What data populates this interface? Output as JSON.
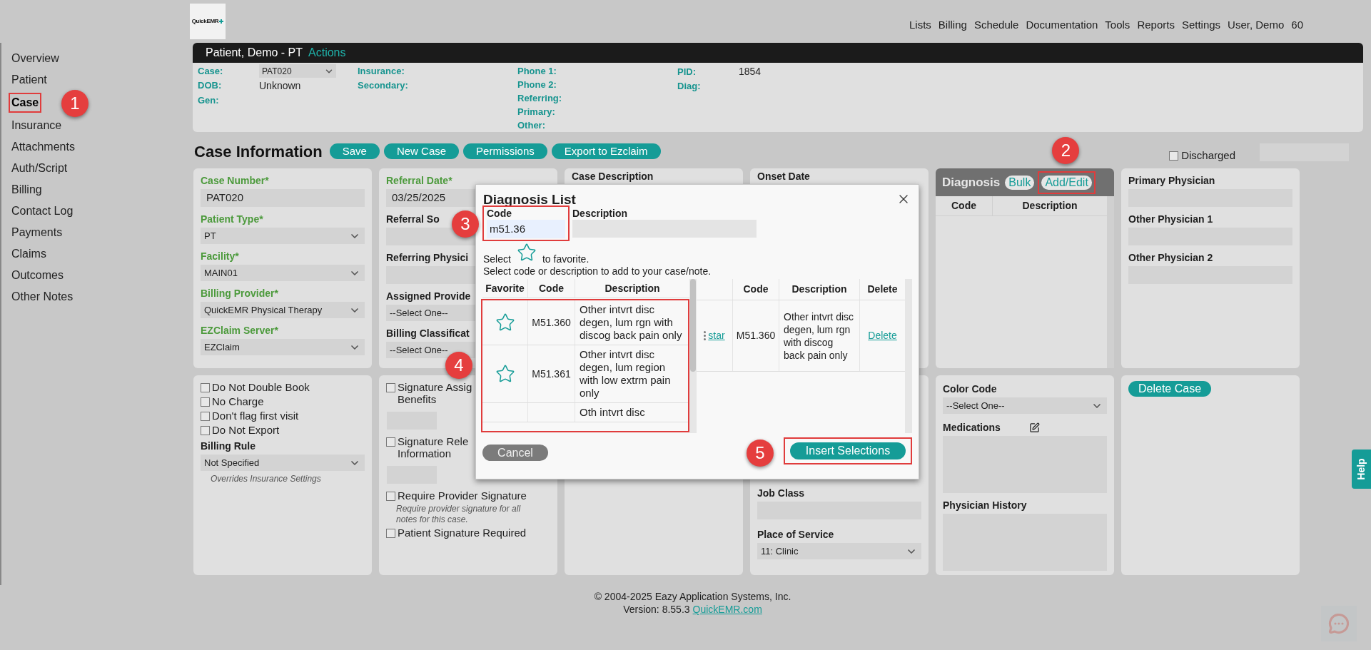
{
  "header": {
    "logo": "QuickEMR",
    "menu": [
      "Lists",
      "Billing",
      "Schedule",
      "Documentation",
      "Tools",
      "Reports",
      "Settings",
      "User, Demo",
      "60"
    ]
  },
  "nav": [
    {
      "label": "Overview",
      "selected": false
    },
    {
      "label": "Patient",
      "selected": false
    },
    {
      "label": "Case",
      "selected": true,
      "callout": "1"
    },
    {
      "label": "Insurance",
      "selected": false
    },
    {
      "label": "Attachments",
      "selected": false
    },
    {
      "label": "Auth/Script",
      "selected": false
    },
    {
      "label": "Billing",
      "selected": false
    },
    {
      "label": "Contact Log",
      "selected": false
    },
    {
      "label": "Payments",
      "selected": false
    },
    {
      "label": "Claims",
      "selected": false
    },
    {
      "label": "Outcomes",
      "selected": false
    },
    {
      "label": "Other Notes",
      "selected": false
    }
  ],
  "patient": {
    "name": "Patient, Demo - PT",
    "actions": "Actions",
    "columns": [
      [
        {
          "label": "Case:",
          "value": "PAT020",
          "kind": "select"
        },
        {
          "label": "DOB:",
          "value": "Unknown",
          "kind": "text"
        },
        {
          "label": "Gen:",
          "kind": "text"
        }
      ],
      [
        {
          "label": "Insurance:",
          "kind": "text"
        },
        {
          "label": "Secondary:",
          "kind": "text"
        }
      ],
      [
        {
          "label": "Phone 1:",
          "kind": "text"
        },
        {
          "label": "Phone 2:",
          "kind": "text"
        },
        {
          "label": "Referring:",
          "kind": "text"
        },
        {
          "label": "Primary:",
          "kind": "text"
        },
        {
          "label": "Other:",
          "kind": "text"
        }
      ],
      [
        {
          "label": "PID:",
          "value": "1854",
          "kind": "text"
        },
        {
          "label": "Diag:",
          "kind": "text"
        }
      ]
    ]
  },
  "case_info": {
    "title": "Case Information",
    "buttons": [
      "Save",
      "New Case",
      "Permissions",
      "Export to Ezclaim"
    ],
    "discharged": {
      "label": "Discharged",
      "checked": false
    }
  },
  "cards_top": [
    {
      "kind": "form",
      "fields": [
        {
          "label": "Case Number*",
          "required": true,
          "kind": "input",
          "value": "PAT020"
        },
        {
          "label": "Patient Type*",
          "required": true,
          "kind": "select",
          "value": "PT"
        },
        {
          "label": "Facility*",
          "required": true,
          "kind": "select",
          "value": "MAIN01"
        },
        {
          "label": "Billing Provider*",
          "required": true,
          "kind": "select",
          "value": "QuickEMR Physical Therapy"
        },
        {
          "label": "EZClaim Server*",
          "required": true,
          "kind": "select",
          "value": "EZClaim"
        }
      ]
    },
    {
      "kind": "form",
      "fields": [
        {
          "label": "Referral Date*",
          "required": true,
          "kind": "input",
          "value": "03/25/2025"
        },
        {
          "label": "Referral So",
          "required": false,
          "kind": "input"
        },
        {
          "label": "Referring Physici",
          "required": false,
          "kind": "input"
        },
        {
          "label": "Assigned Provide",
          "required": false,
          "kind": "select-cut",
          "value": "--Select One--"
        },
        {
          "label": "Billing Classificat",
          "required": false,
          "kind": "select-cut",
          "value": "--Select One--"
        }
      ]
    },
    {
      "kind": "form",
      "fields": [
        {
          "label": "Case Description",
          "required": false,
          "kind": "label"
        }
      ]
    },
    {
      "kind": "form",
      "fields": [
        {
          "label": "Onset Date",
          "required": false,
          "kind": "label"
        }
      ]
    },
    {
      "kind": "diagnosis",
      "title": "Diagnosis",
      "buttons": [
        {
          "label": "Bulk"
        },
        {
          "label": "Add/Edit",
          "callout": "2"
        }
      ],
      "columns": [
        "Code",
        "Description"
      ]
    },
    {
      "kind": "form",
      "fields": [
        {
          "label": "Primary Physician",
          "required": false,
          "kind": "input"
        },
        {
          "label": "Other Physician 1",
          "required": false,
          "kind": "input"
        },
        {
          "label": "Other Physician 2",
          "required": false,
          "kind": "input"
        }
      ]
    }
  ],
  "cards_bottom": [
    {
      "items": [
        {
          "kind": "checkbox",
          "lines": [
            "Do Not Double Book"
          ],
          "checked": false
        },
        {
          "kind": "checkbox",
          "lines": [
            "No Charge"
          ],
          "checked": false
        },
        {
          "kind": "checkbox",
          "lines": [
            "Don't flag first visit"
          ],
          "checked": false
        },
        {
          "kind": "checkbox",
          "lines": [
            "Do Not Export"
          ],
          "checked": false
        },
        {
          "kind": "label",
          "text": "Billing Rule"
        },
        {
          "kind": "select",
          "value": "Not Specified"
        },
        {
          "kind": "note",
          "text": "Overrides Insurance Settings"
        }
      ]
    },
    {
      "items": [
        {
          "kind": "checkbox",
          "lines": [
            "Signature Assig",
            "Benefits"
          ],
          "checked": false
        },
        {
          "kind": "short-input"
        },
        {
          "kind": "checkbox",
          "lines": [
            "Signature Rele",
            "Information"
          ],
          "checked": false
        },
        {
          "kind": "short-input"
        },
        {
          "kind": "checkbox",
          "lines": [
            "Require Provider Signature"
          ],
          "checked": false
        },
        {
          "kind": "note",
          "text": "Require provider signature for all notes for this case."
        },
        {
          "kind": "checkbox",
          "lines": [
            "Patient Signature Required"
          ],
          "checked": false
        }
      ]
    },
    {
      "kind": "blank"
    },
    {
      "bottom": true,
      "items": [
        {
          "kind": "label",
          "text": "Job Class"
        },
        {
          "kind": "input"
        },
        {
          "kind": "label",
          "text": "Place of Service"
        },
        {
          "kind": "select",
          "value": "11: Clinic"
        }
      ]
    },
    {
      "items": [
        {
          "kind": "label",
          "text": "Color Code"
        },
        {
          "kind": "select",
          "value": "--Select One--"
        },
        {
          "kind": "label-edit",
          "text": "Medications"
        },
        {
          "kind": "textarea"
        },
        {
          "kind": "label",
          "text": "Physician History"
        },
        {
          "kind": "textarea"
        }
      ]
    },
    {
      "items": [
        {
          "kind": "button",
          "text": "Delete Case"
        }
      ]
    }
  ],
  "modal": {
    "title": "Diagnosis List",
    "code": {
      "label": "Code",
      "value": "m51.36",
      "callout": "3"
    },
    "description": {
      "label": "Description"
    },
    "hint_before": "Select",
    "hint_after": "to favorite.",
    "hint2": "Select code or description to add to your case/note.",
    "results": {
      "callout": "4",
      "columns": [
        "Favorite",
        "Code",
        "Description"
      ],
      "rows": [
        {
          "code": "M51.360",
          "description": "Other intvrt disc degen, lum rgn with discog back pain only"
        },
        {
          "code": "M51.361",
          "description": "Other intvrt disc degen, lum region with low extrm pain only"
        },
        {
          "description": "Oth intvrt disc"
        }
      ]
    },
    "selected": {
      "columns": [
        "Code",
        "Description",
        "Delete"
      ],
      "rows": [
        {
          "link": "star",
          "code": "M51.360",
          "description": "Other intvrt disc degen, lum rgn with discog back pain only",
          "action": "Delete"
        }
      ]
    },
    "cancel": "Cancel",
    "insert": {
      "label": "Insert Selections",
      "callout": "5"
    }
  },
  "footer": {
    "copyright": "© 2004-2025 Eazy Application Systems, Inc.",
    "version": "Version: 8.55.3",
    "link": "QuickEMR.com"
  },
  "help": "Help"
}
